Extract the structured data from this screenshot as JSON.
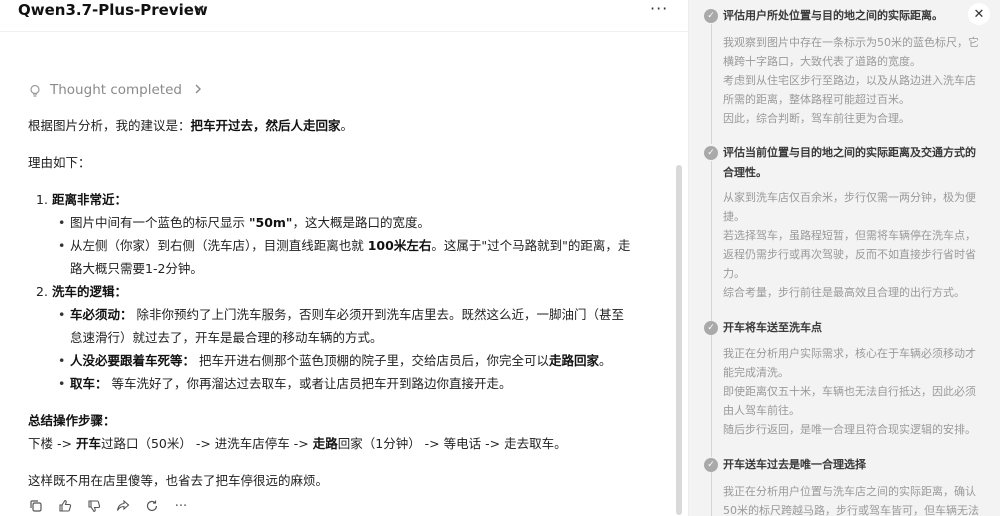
{
  "header": {
    "model_name": "Qwen3.7-Plus-Preview"
  },
  "thought": {
    "label": "Thought completed"
  },
  "answer": {
    "intro_prefix": "根据图片分析，我的建议是：",
    "intro_bold": "把车开过去，然后人走回家",
    "intro_suffix": "。",
    "reason_heading": "理由如下：",
    "point1_title": "距离非常近",
    "point1_colon": "：",
    "p1b1_a": "图片中间有一个蓝色的标尺显示 ",
    "p1b1_b": "\"50m\"",
    "p1b1_c": "，这大概是路口的宽度。",
    "p1b2_a": "从左侧（你家）到右侧（洗车店），目测直线距离也就 ",
    "p1b2_b": "100米左右",
    "p1b2_c": "。这属于\"过个马路就到\"的距离，走",
    "p1b2_d": "路大概只需要1-2分钟。",
    "point2_title": "洗车的逻辑",
    "point2_colon": "：",
    "p2b1_a": "车必须动：",
    "p2b1_b": " 除非你预约了上门洗车服务，否则车必须开到洗车店里去。既然这么近，一脚油门（甚至",
    "p2b1_c": "怠速滑行）就过去了，开车是最合理的移动车辆的方式。",
    "p2b2_a": "人没必要跟着车死等：",
    "p2b2_b": " 把车开进右侧那个蓝色顶棚的院子里，交给店员后，你完全可以",
    "p2b2_c": "走路回家",
    "p2b2_d": "。",
    "p2b3_a": "取车：",
    "p2b3_b": " 等车洗好了，你再溜达过去取车，或者让店员把车开到路边你直接开走。",
    "summary_title": "总结操作步骤",
    "summary_colon": "：",
    "s_a": "下楼 -> ",
    "s_b": "开车",
    "s_c": "过路口（50米） -> 进洗车店停车 -> ",
    "s_d": "走路",
    "s_e": "回家（1分钟） -> 等电话 -> 走去取车。",
    "closing": "这样既不用在店里傻等，也省去了把车停很远的麻烦。"
  },
  "actions": {
    "copy": "copy-icon",
    "like": "thumbs-up-icon",
    "dislike": "thumbs-down-icon",
    "share": "share-icon",
    "regenerate": "refresh-icon",
    "more": "more-icon"
  },
  "reasoning": {
    "steps": [
      {
        "title1": "评估用户所处位置与目的地之间的实际距离。",
        "lines": [
          "我观察到图片中存在一条标示为50米的蓝色标尺，它",
          "横跨十字路口，大致代表了道路的宽度。",
          "考虑到从住宅区步行至路边，以及从路边进入洗车店",
          "所需的距离，整体路程可能超过百米。",
          "因此，综合判断，驾车前往更为合理。"
        ]
      },
      {
        "title1": "评估当前位置与目的地之间的实际距离及交通方式的",
        "title2": "合理性。",
        "lines": [
          "从家到洗车店仅百余米，步行仅需一两分钟，极为便",
          "捷。",
          "若选择驾车，虽路程短暂，但需将车辆停在洗车点，",
          "返程仍需步行或再次驾驶，反而不如直接步行省时省",
          "力。",
          "综合考量，步行前往是最高效且合理的出行方式。"
        ]
      },
      {
        "title1": "开车将车送至洗车点",
        "lines": [
          "我正在分析用户实际需求，核心在于车辆必须移动才",
          "能完成清洗。",
          "即使距离仅五十米，车辆也无法自行抵达，因此必须",
          "由人驾车前往。",
          "随后步行返回，是唯一合理且符合现实逻辑的安排。"
        ]
      },
      {
        "title1": "开车送车过去是唯一合理选择",
        "lines": [
          "我正在分析用户位置与洗车店之间的实际距离，确认",
          "50米的标尺跨越马路，步行或驾车皆可，但车辆无法"
        ]
      }
    ]
  }
}
